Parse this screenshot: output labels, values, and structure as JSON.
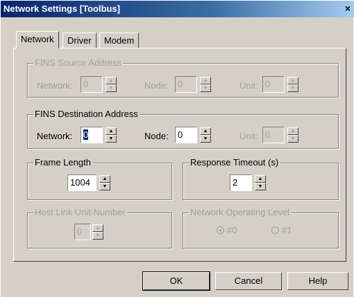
{
  "window": {
    "title": "Network Settings [Toolbus]",
    "close_glyph": "×"
  },
  "tabs": [
    {
      "label": "Network"
    },
    {
      "label": "Driver"
    },
    {
      "label": "Modem"
    }
  ],
  "fins_source": {
    "title": "FINS Source Address",
    "network_label": "Network:",
    "network_value": "0",
    "node_label": "Node:",
    "node_value": "0",
    "unit_label": "Unit:",
    "unit_value": "0"
  },
  "fins_destination": {
    "title": "FINS Destination Address",
    "network_label": "Network:",
    "network_value": "0",
    "node_label": "Node:",
    "node_value": "0",
    "unit_label": "Unit:",
    "unit_value": "0"
  },
  "frame_length": {
    "title": "Frame Length",
    "value": "1004"
  },
  "response_timeout": {
    "title": "Response Timeout (s)",
    "value": "2"
  },
  "host_link": {
    "title": "Host Link Unit Number",
    "value": "0"
  },
  "operating_level": {
    "title": "Network Operating Level",
    "options": [
      {
        "label": "#0",
        "selected": true
      },
      {
        "label": "#1",
        "selected": false
      }
    ]
  },
  "buttons": {
    "ok": "OK",
    "cancel": "Cancel",
    "help": "Help"
  },
  "icons": {
    "up": "▲",
    "down": "▼"
  }
}
